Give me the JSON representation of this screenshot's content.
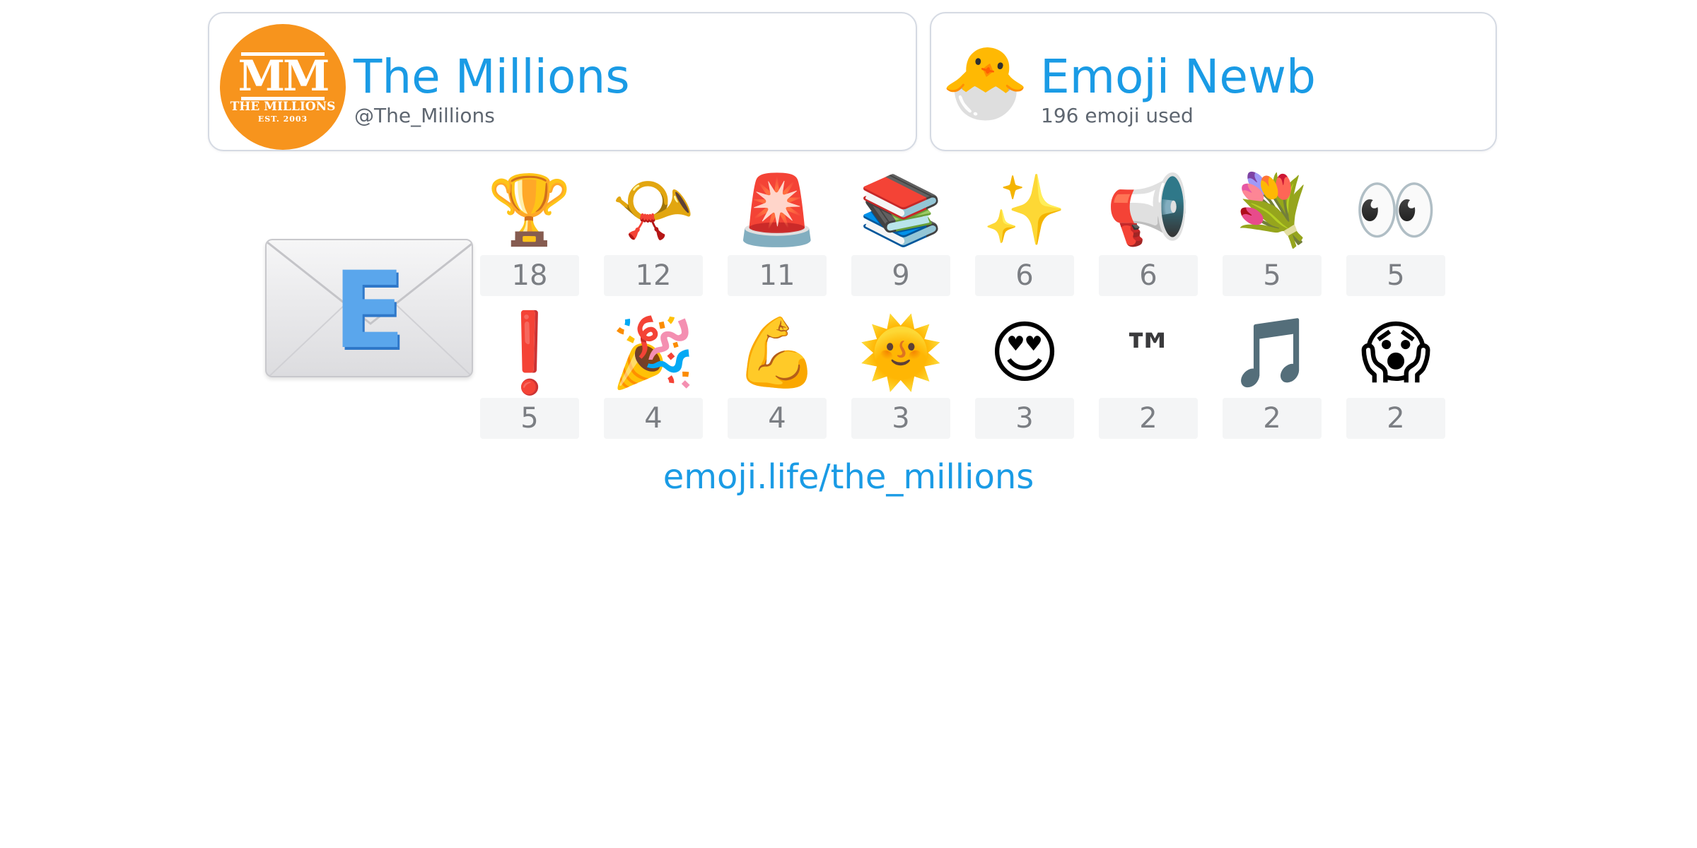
{
  "profile": {
    "name": "The Millions",
    "handle": "@The_Millions",
    "avatar": {
      "monogram": "MM",
      "name": "THE MILLIONS",
      "est": "EST. 2003",
      "color": "#f7941d"
    }
  },
  "badge": {
    "title": "Emoji Newb",
    "subtitle": "196 emoji used",
    "emoji": "🐣"
  },
  "feature_emoji": {
    "name": "e-mail-icon",
    "letter": "E"
  },
  "emoji_stats": [
    {
      "emoji": "🏆",
      "count": "18",
      "name": "trophy-icon"
    },
    {
      "emoji": "📯",
      "count": "12",
      "name": "postal-horn-icon"
    },
    {
      "emoji": "🚨",
      "count": "11",
      "name": "police-light-icon"
    },
    {
      "emoji": "📚",
      "count": "9",
      "name": "books-icon"
    },
    {
      "emoji": "✨",
      "count": "6",
      "name": "sparkles-icon"
    },
    {
      "emoji": "📢",
      "count": "6",
      "name": "loudspeaker-icon"
    },
    {
      "emoji": "💐",
      "count": "5",
      "name": "bouquet-icon"
    },
    {
      "emoji": "👀",
      "count": "5",
      "name": "eyes-icon"
    },
    {
      "emoji": "❗",
      "count": "5",
      "name": "exclamation-icon"
    },
    {
      "emoji": "🎉",
      "count": "4",
      "name": "party-popper-icon"
    },
    {
      "emoji": "💪",
      "count": "4",
      "name": "flexed-biceps-icon"
    },
    {
      "emoji": "🌞",
      "count": "3",
      "name": "sun-with-face-icon"
    },
    {
      "emoji": "😍",
      "count": "3",
      "name": "heart-eyes-icon"
    },
    {
      "emoji": "™",
      "count": "2",
      "name": "trademark-icon"
    },
    {
      "emoji": "🎵",
      "count": "2",
      "name": "musical-note-icon"
    },
    {
      "emoji": "😱",
      "count": "2",
      "name": "screaming-face-icon"
    }
  ],
  "footer": {
    "link": "emoji.life/the_millions"
  },
  "colors": {
    "accent": "#1a9be5",
    "muted_text": "#5e6670",
    "count_text": "#7b7e83",
    "count_bg": "#f4f5f6",
    "card_border": "#d5dae3"
  }
}
